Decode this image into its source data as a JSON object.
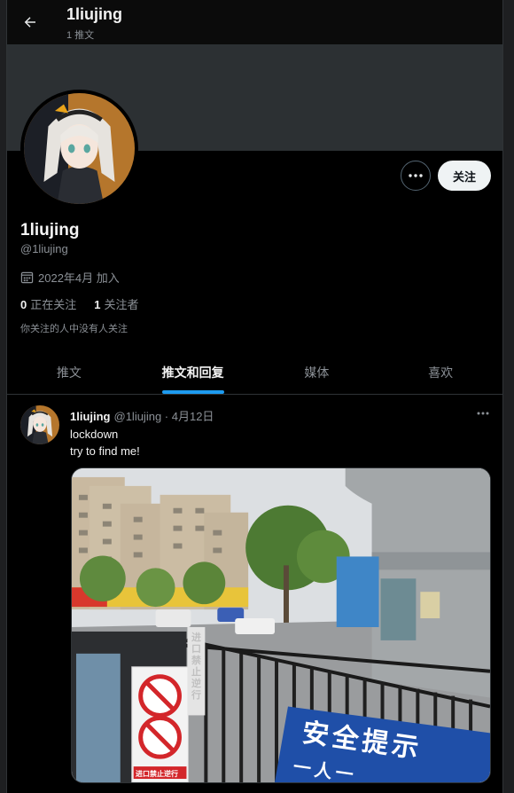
{
  "header": {
    "title": "1liujing",
    "post_count": "1 推文",
    "back_icon": "arrow-left-icon"
  },
  "profile": {
    "display_name": "1liujing",
    "handle": "@1liujing",
    "joined": "2022年4月 加入",
    "following_count": "0",
    "following_label": "正在关注",
    "followers_count": "1",
    "followers_label": "关注者",
    "followers_you_know": "你关注的人中没有人关注",
    "follow_button": "关注",
    "more_icon": "more-horizontal-icon",
    "calendar_icon": "calendar-icon"
  },
  "tabs": [
    {
      "label": "推文",
      "active": false
    },
    {
      "label": "推文和回复",
      "active": true
    },
    {
      "label": "媒体",
      "active": false
    },
    {
      "label": "喜欢",
      "active": false
    }
  ],
  "tweet": {
    "name": "1liujing",
    "handle": "@1liujing",
    "date": "· 4月12日",
    "lines": [
      "lockdown",
      "try to find me!"
    ],
    "image_signs": {
      "banner_text": "安全提示",
      "banner_text2": "一人一",
      "gate_sign": "进口禁止逆行",
      "pole_sign": "进口禁止逆行"
    }
  },
  "colors": {
    "accent": "#1d9bf0",
    "background": "#000000",
    "banner": "#2c3033",
    "muted_text": "#8b9096"
  }
}
